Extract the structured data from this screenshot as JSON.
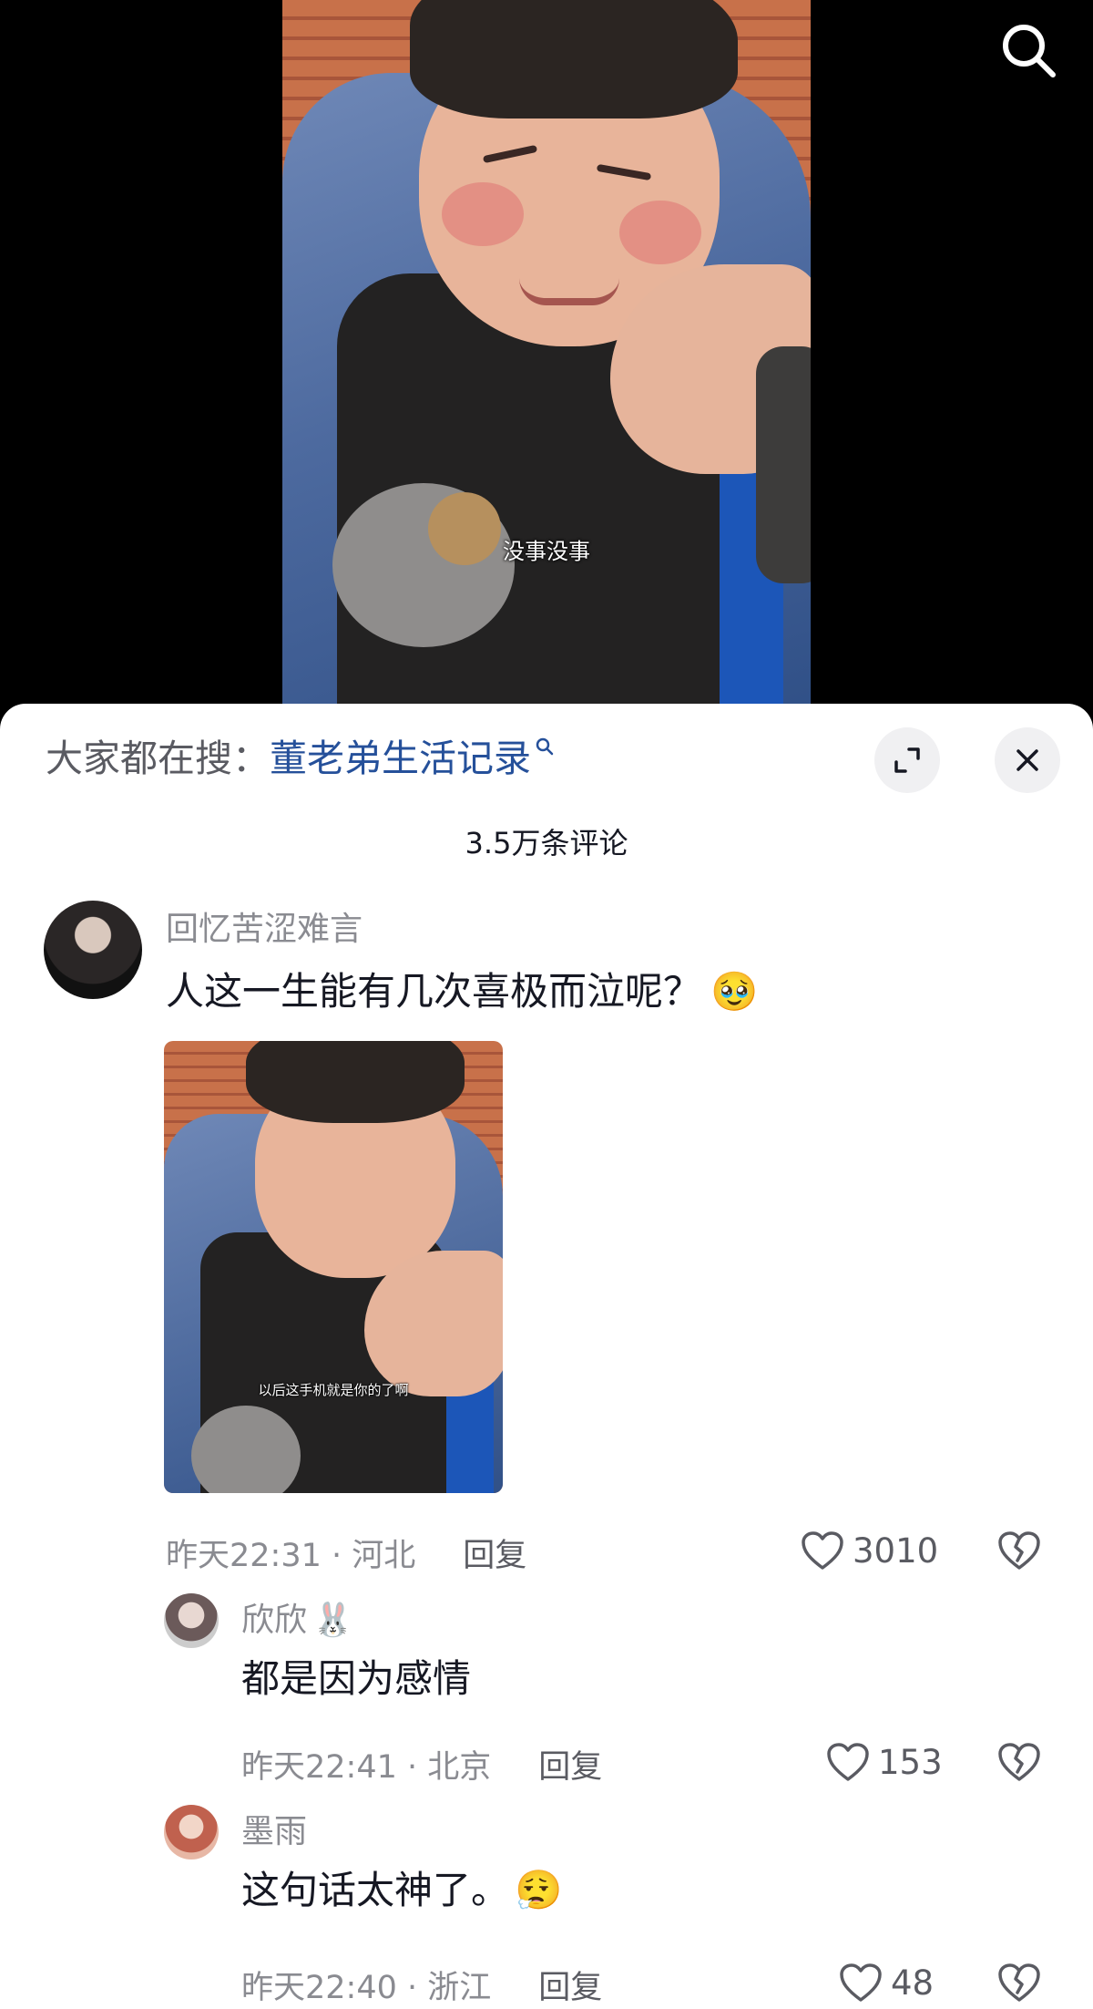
{
  "video": {
    "subtitle": "没事没事"
  },
  "search_hint": {
    "prefix": "大家都在搜：",
    "keyword": "董老弟生活记录"
  },
  "comment_count": "3.5万条评论",
  "comments": [
    {
      "username": "回忆苦涩难言",
      "text": "人这一生能有几次喜极而泣呢？",
      "emoji": "🥹",
      "image_subtitle": "以后这手机就是你的了啊",
      "time": "昨天22:31",
      "location": "河北",
      "reply_label": "回复",
      "likes": "3010"
    }
  ],
  "replies": [
    {
      "username": "欣欣",
      "username_emoji": "🐰",
      "text": "都是因为感情",
      "time": "昨天22:41",
      "location": "北京",
      "reply_label": "回复",
      "likes": "153"
    },
    {
      "username": "墨雨",
      "text": "这句话太神了。",
      "emoji": "😮‍💨",
      "time": "昨天22:40",
      "location": "浙江",
      "reply_label": "回复",
      "likes": "48"
    }
  ],
  "colors": {
    "keyword": "#25509a",
    "muted_text": "#8a8b91",
    "primary_text": "#161823",
    "sheet_bg": "#ffffff"
  }
}
